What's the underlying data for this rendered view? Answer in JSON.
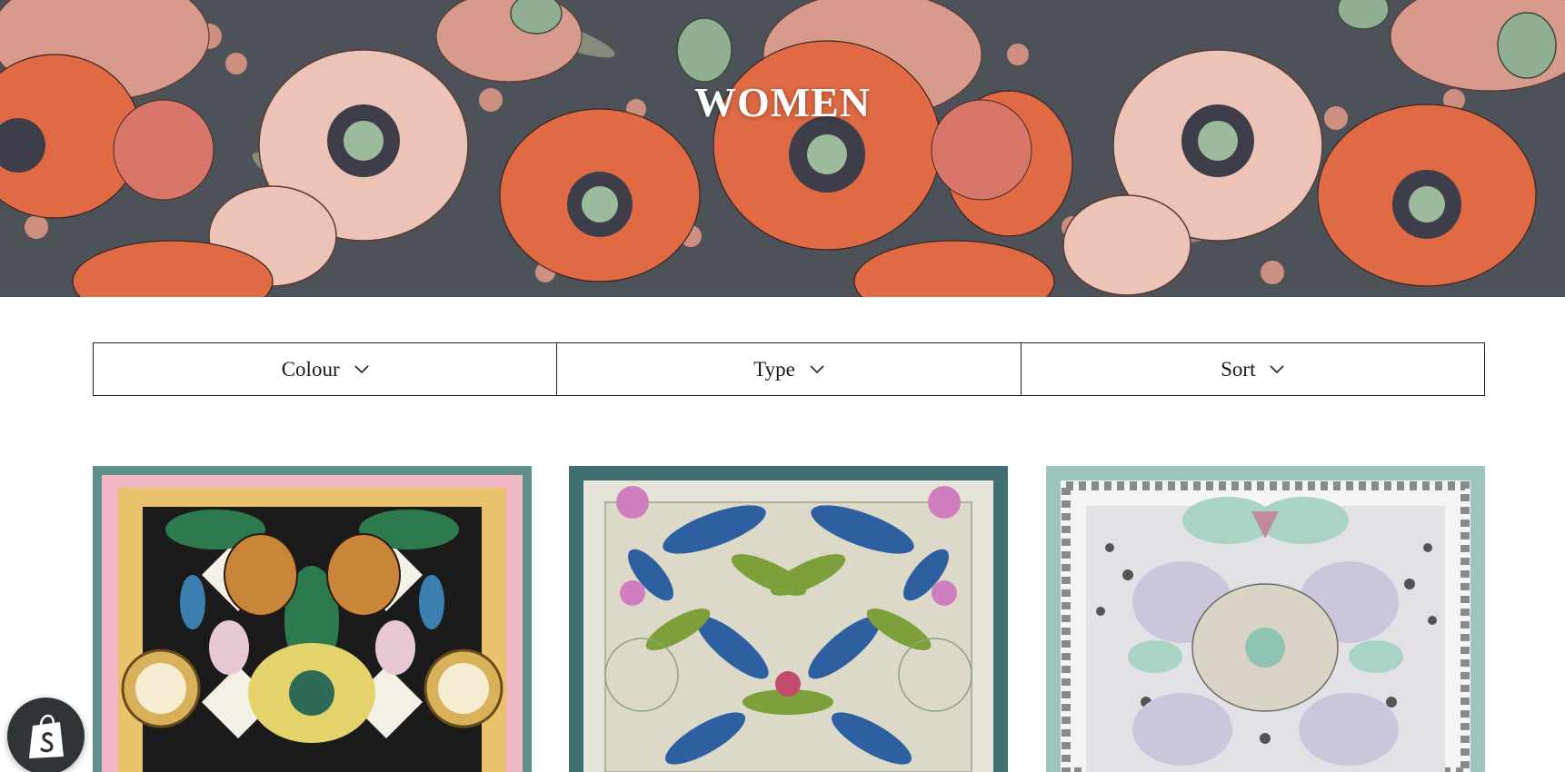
{
  "hero": {
    "title": "WOMEN"
  },
  "filters": [
    {
      "label": "Colour",
      "icon": "chevron-down-icon"
    },
    {
      "label": "Type",
      "icon": "chevron-down-icon"
    },
    {
      "label": "Sort",
      "icon": "chevron-down-icon"
    }
  ],
  "products": [
    {
      "image": "scarf-tiger-clock-print",
      "border_color": "#5e8f8a",
      "bg_color": "#f2b7c4"
    },
    {
      "image": "scarf-hummingbird-print",
      "border_color": "#3f6f70",
      "bg_color": "#e6e3d8"
    },
    {
      "image": "scarf-leopard-greek-key-print",
      "border_color": "#9cc6bc",
      "bg_color": "#f4f4f4"
    }
  ],
  "badge": {
    "icon": "shopify-bag-icon"
  },
  "colors": {
    "hero_bg": "#4a4f56",
    "poppy": "#e06a44",
    "petal_pink": "#e9b9ad",
    "pod_green": "#8fae92"
  }
}
